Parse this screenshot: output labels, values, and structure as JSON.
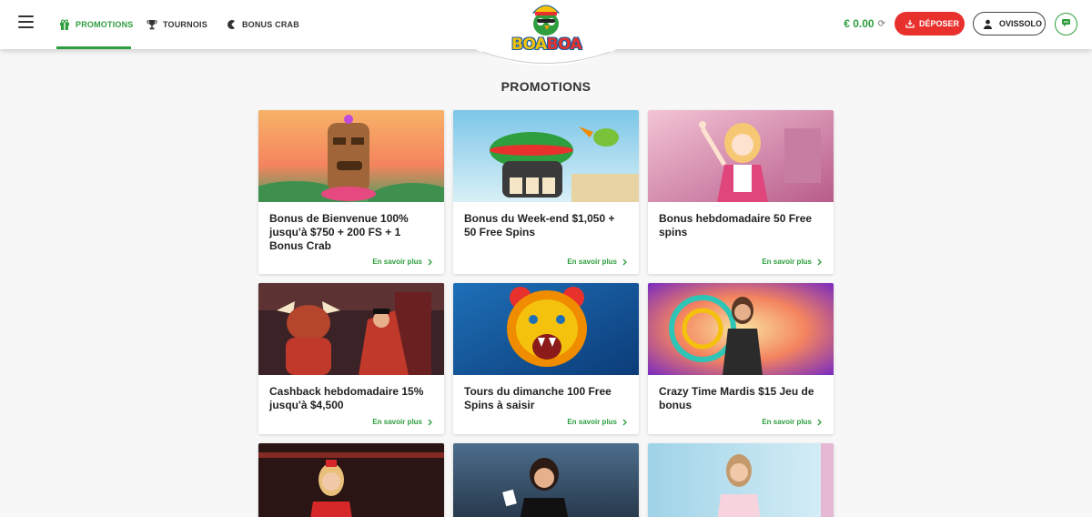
{
  "header": {
    "nav": [
      {
        "label": "PROMOTIONS",
        "icon": "gift-icon",
        "active": true
      },
      {
        "label": "TOURNOIS",
        "icon": "trophy-icon",
        "active": false
      },
      {
        "label": "BONUS CRAB",
        "icon": "crab-claw-icon",
        "active": false
      }
    ],
    "logo_text": [
      "BOA",
      "BOA"
    ],
    "balance": "€ 0.00",
    "deposit_label": "DÉPOSER",
    "user_label": "OVISSOLO"
  },
  "page": {
    "title": "PROMOTIONS"
  },
  "promos": [
    {
      "title": "Bonus de Bienvenue 100% jusqu'à $750 + 200 FS + 1 Bonus Crab",
      "more": "En savoir plus"
    },
    {
      "title": "Bonus du Week-end $1,050 + 50 Free Spins",
      "more": "En savoir plus"
    },
    {
      "title": "Bonus hebdomadaire 50 Free spins",
      "more": "En savoir plus"
    },
    {
      "title": "Cashback hebdomadaire 15% jusqu'à $4,500",
      "more": "En savoir plus"
    },
    {
      "title": "Tours du dimanche 100 Free Spins à saisir",
      "more": "En savoir plus"
    },
    {
      "title": "Crazy Time Mardis $15 Jeu de bonus",
      "more": "En savoir plus"
    }
  ],
  "colors": {
    "accent_green": "#2e9e3e",
    "deposit_red": "#e8312d",
    "logo_yellow": "#f4c20d",
    "logo_blue": "#1b5e9b"
  }
}
